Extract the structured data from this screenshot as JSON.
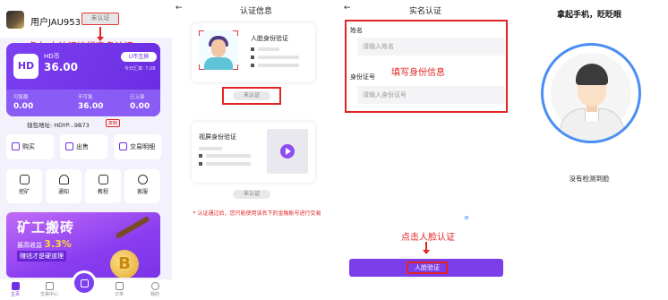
{
  "colors": {
    "brand_purple": "#7b3ee8",
    "annotation_red": "#e12424",
    "ring_blue": "#4a8ef5"
  },
  "screen1": {
    "user": {
      "username": "用户JAU953",
      "verify_status": "未认证"
    },
    "annotation": "点击 未认证进行实名认证",
    "wallet": {
      "coin_name": "HD币",
      "balance": "36.00",
      "swap_label": "U币互换",
      "rate": "今日汇率: 7.08",
      "stats": [
        {
          "label": "可售额",
          "value": "0.00"
        },
        {
          "label": "不可售",
          "value": "36.00"
        },
        {
          "label": "已上架",
          "value": "0.00"
        }
      ],
      "address": "钱包地址: HDYP...9B73",
      "copy_label": "复制"
    },
    "actions": [
      {
        "icon": "cart-icon",
        "label": "购买"
      },
      {
        "icon": "upload-icon",
        "label": "出售"
      },
      {
        "icon": "list-icon",
        "label": "交易明细"
      }
    ],
    "grid": [
      {
        "icon": "pickaxe-icon",
        "label": "挖矿"
      },
      {
        "icon": "bell-icon",
        "label": "通知"
      },
      {
        "icon": "video-icon",
        "label": "教程"
      },
      {
        "icon": "headset-icon",
        "label": "客服"
      }
    ],
    "banner": {
      "title": "矿工搬砖",
      "sub1_prefix": "最高收益",
      "sub1_value": "3.3%",
      "sub2": "赚钱才是硬道理",
      "coin_glyph": "B"
    },
    "tabs": [
      {
        "label": "主页",
        "active": true
      },
      {
        "label": "交易中心",
        "active": false
      },
      {
        "label": "订单",
        "active": false
      },
      {
        "label": "我的",
        "active": false
      }
    ]
  },
  "screen2": {
    "back_glyph": "←",
    "title": "认证信息",
    "face_card": {
      "heading": "人脸身份验证",
      "button": "未认证"
    },
    "video_card": {
      "heading": "视屏身份验证",
      "button": "未认证"
    },
    "notice": "* 认证通过后，您只能使用该名下的金融账号进行交易"
  },
  "screen3": {
    "back_glyph": "←",
    "title": "实名认证",
    "name_label": "姓名",
    "name_placeholder": "请输入姓名",
    "id_label": "身份证号",
    "id_placeholder": "请输入身份证号",
    "annotation_fill": "填写身份信息",
    "annotation_click": "点击人脸认证",
    "submit": "人脸验证"
  },
  "screen4": {
    "title": "拿起手机，眨眨眼",
    "status": "没有检测到脸"
  }
}
